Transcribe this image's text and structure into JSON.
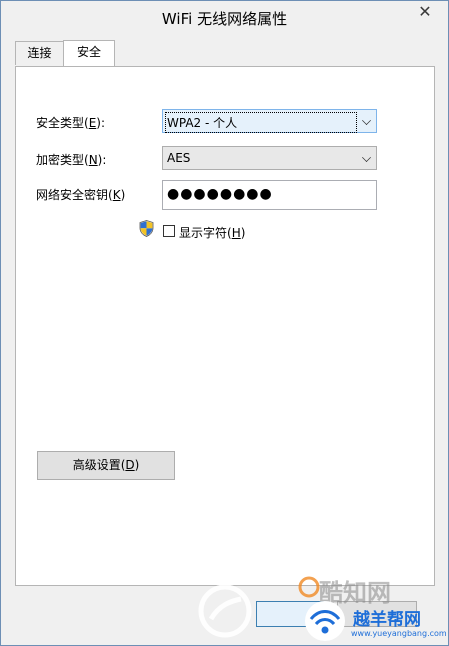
{
  "window": {
    "title": "WiFi 无线网络属性",
    "close_glyph": "✕"
  },
  "tabs": [
    {
      "label": "连接",
      "active": false
    },
    {
      "label": "安全",
      "active": true
    }
  ],
  "security_type": {
    "label_text": "安全类型(",
    "label_key": "E",
    "label_end": "):",
    "value": "WPA2 - 个人"
  },
  "encryption_type": {
    "label_text": "加密类型(",
    "label_key": "N",
    "label_end": "):",
    "value": "AES"
  },
  "network_key": {
    "label_text": "网络安全密钥(",
    "label_key": "K",
    "label_end": ")",
    "value": "●●●●●●●●"
  },
  "show_chars": {
    "label_text": "显示字符(",
    "label_key": "H",
    "label_end": ")",
    "checked": false
  },
  "advanced_button": {
    "label_text": "高级设置(",
    "label_key": "D",
    "label_end": ")"
  },
  "watermarks": {
    "kuzhi": "酷知网",
    "yueyang": "越羊帮网",
    "url": "www.yueyangbang.com"
  },
  "colors": {
    "window_border": "#6d8fb5",
    "focus_blue": "#7eb4ea",
    "watermark_blue": "#1e6ed8",
    "watermark_orange": "#f08a24"
  }
}
